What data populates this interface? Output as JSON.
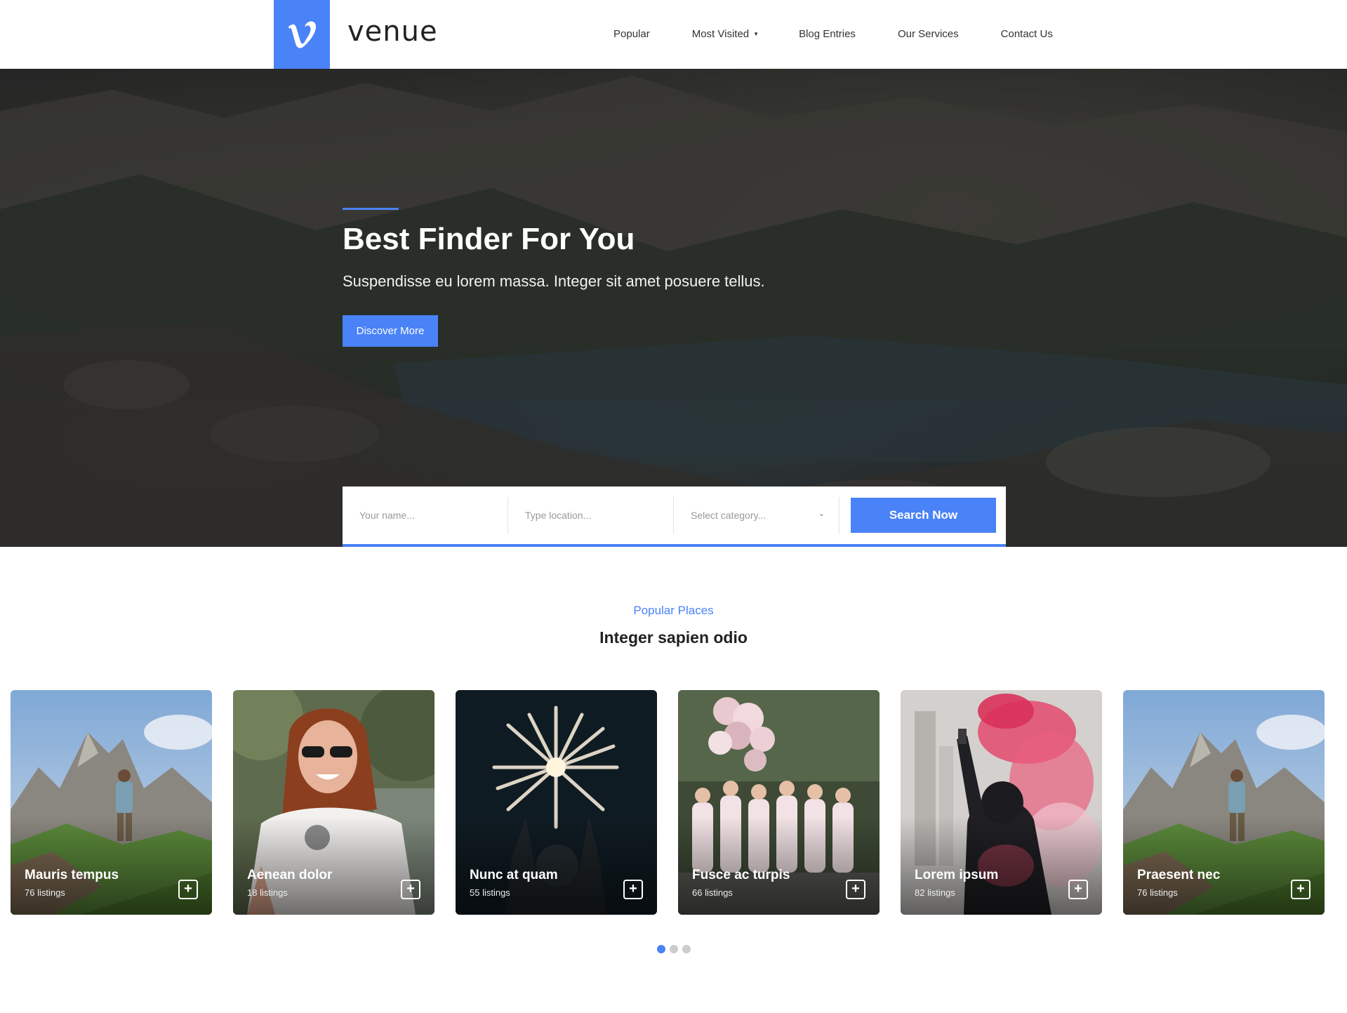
{
  "brand": {
    "logo_letter": "v",
    "name": "venue",
    "accent": "#4a82f7"
  },
  "nav": [
    {
      "label": "Popular"
    },
    {
      "label": "Most Visited",
      "has_dropdown": true
    },
    {
      "label": "Blog Entries"
    },
    {
      "label": "Our Services"
    },
    {
      "label": "Contact Us"
    }
  ],
  "hero": {
    "title": "Best Finder For You",
    "subtitle": "Suspendisse eu lorem massa. Integer sit amet posuere tellus.",
    "cta_label": "Discover More"
  },
  "search": {
    "name_placeholder": "Your name...",
    "location_placeholder": "Type location...",
    "category_placeholder": "Select category...",
    "button_label": "Search Now"
  },
  "section": {
    "eyebrow": "Popular Places",
    "title": "Integer sapien odio"
  },
  "cards": [
    {
      "title": "Mauris tempus",
      "count": "76 listings",
      "image": "mountain-hiker"
    },
    {
      "title": "Aenean dolor",
      "count": "18 listings",
      "image": "woman-sunglasses"
    },
    {
      "title": "Nunc at quam",
      "count": "55 listings",
      "image": "fireworks"
    },
    {
      "title": "Fusce ac turpis",
      "count": "66 listings",
      "image": "party-balloons"
    },
    {
      "title": "Lorem ipsum",
      "count": "82 listings",
      "image": "smoke-flare"
    },
    {
      "title": "Praesent nec",
      "count": "76 listings",
      "image": "mountain-hiker"
    }
  ],
  "carousel": {
    "pages": 3,
    "active": 1
  },
  "icons": {
    "plus": "plus-icon",
    "caret": "caret-down-icon",
    "chevron": "chevron-down-icon"
  }
}
